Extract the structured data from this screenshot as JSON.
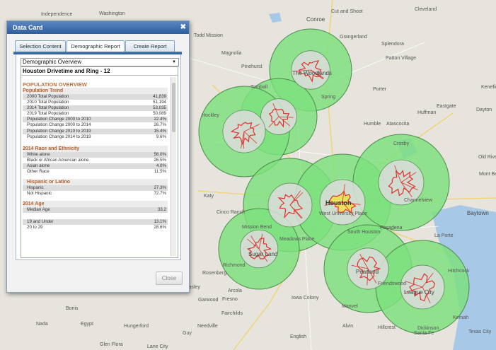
{
  "dialog": {
    "title": "Data Card",
    "close_icon": "close-icon",
    "tabs": [
      {
        "label": "Selection Content"
      },
      {
        "label": "Demographic Report"
      },
      {
        "label": "Create Report"
      }
    ],
    "active_tab": "Demographic Report",
    "select_value": "Demographic Overview",
    "report_title": "Houston Drivetime and Ring - 12",
    "close_button": "Close"
  },
  "report": {
    "overview_heading": "POPULATION OVERVIEW",
    "population_trend_heading": "Population Trend",
    "population_trend": [
      {
        "label": "2000 Total Population",
        "value": "41,839"
      },
      {
        "label": "2010 Total Population",
        "value": "51,194"
      },
      {
        "label": "2014 Total Population",
        "value": "53,035"
      },
      {
        "label": "2019 Total Population",
        "value": "50,089"
      },
      {
        "label": "Population Change 2000 to 2010",
        "value": "22.4%"
      },
      {
        "label": "Population Change 2000 to 2014",
        "value": "26.7%"
      },
      {
        "label": "Population Change 2010 to 2019",
        "value": "15.4%"
      },
      {
        "label": "Population Change 2014 to 2019",
        "value": "9.6%"
      }
    ],
    "race_heading": "2014 Race and Ethnicity",
    "race": [
      {
        "label": "White alone",
        "value": "56.0%"
      },
      {
        "label": "Black or African American alone",
        "value": "26.5%"
      },
      {
        "label": "Asian alone",
        "value": "4.0%"
      },
      {
        "label": "Other Race",
        "value": "11.5%"
      }
    ],
    "hispanic_heading": "Hispanic or Latino",
    "hispanic": [
      {
        "label": "Hispanic",
        "value": "27.3%"
      },
      {
        "label": "Not Hispanic",
        "value": "72.7%"
      }
    ],
    "age_heading": "2014 Age",
    "age": [
      {
        "label": "Median Age",
        "value": "33.2"
      },
      {
        "label": "",
        "value": ""
      },
      {
        "label": "19 and Under",
        "value": "13.1%"
      },
      {
        "label": "20 to 29",
        "value": "28.6%"
      }
    ]
  },
  "map": {
    "labels": [
      {
        "text": "Independence",
        "cls": ""
      },
      {
        "text": "Washington",
        "cls": ""
      },
      {
        "text": "Todd Mission",
        "cls": ""
      },
      {
        "text": "Magnolia",
        "cls": ""
      },
      {
        "text": "Pinehurst",
        "cls": ""
      },
      {
        "text": "Conroe",
        "cls": "mid"
      },
      {
        "text": "Cut and Shoot",
        "cls": ""
      },
      {
        "text": "Cleveland",
        "cls": ""
      },
      {
        "text": "Grangerland",
        "cls": ""
      },
      {
        "text": "Splendora",
        "cls": ""
      },
      {
        "text": "Patton Village",
        "cls": ""
      },
      {
        "text": "The Woodlands",
        "cls": "mid"
      },
      {
        "text": "Porter",
        "cls": ""
      },
      {
        "text": "Tomball",
        "cls": ""
      },
      {
        "text": "Spring",
        "cls": ""
      },
      {
        "text": "Kenefick",
        "cls": ""
      },
      {
        "text": "Hockley",
        "cls": ""
      },
      {
        "text": "Humble",
        "cls": ""
      },
      {
        "text": "Atascocita",
        "cls": ""
      },
      {
        "text": "Huffman",
        "cls": ""
      },
      {
        "text": "Eastgate",
        "cls": ""
      },
      {
        "text": "Dayton",
        "cls": ""
      },
      {
        "text": "Crosby",
        "cls": ""
      },
      {
        "text": "Old River-",
        "cls": ""
      },
      {
        "text": "Mont Belvieu",
        "cls": ""
      },
      {
        "text": "Katy",
        "cls": ""
      },
      {
        "text": "Houston",
        "cls": "big"
      },
      {
        "text": "Channelview",
        "cls": ""
      },
      {
        "text": "Cinco Ranch",
        "cls": ""
      },
      {
        "text": "West University Place",
        "cls": ""
      },
      {
        "text": "Baytown",
        "cls": "mid"
      },
      {
        "text": "Mission Bend",
        "cls": ""
      },
      {
        "text": "Meadows Place",
        "cls": ""
      },
      {
        "text": "Pasadena",
        "cls": ""
      },
      {
        "text": "Sugar Land",
        "cls": "mid"
      },
      {
        "text": "South Houston",
        "cls": ""
      },
      {
        "text": "La Porte",
        "cls": ""
      },
      {
        "text": "Pearland",
        "cls": "mid"
      },
      {
        "text": "Friendswood",
        "cls": ""
      },
      {
        "text": "League City",
        "cls": "mid"
      },
      {
        "text": "Richmond",
        "cls": ""
      },
      {
        "text": "Rosenberg",
        "cls": ""
      },
      {
        "text": "Beasley",
        "cls": ""
      },
      {
        "text": "Arcola",
        "cls": ""
      },
      {
        "text": "Fresno",
        "cls": ""
      },
      {
        "text": "Manvel",
        "cls": ""
      },
      {
        "text": "Iowa Colony",
        "cls": ""
      },
      {
        "text": "Alvin",
        "cls": ""
      },
      {
        "text": "Dickinson",
        "cls": ""
      },
      {
        "text": "Kemah",
        "cls": ""
      },
      {
        "text": "Santa Fe",
        "cls": ""
      },
      {
        "text": "Texas City",
        "cls": ""
      },
      {
        "text": "Garwood",
        "cls": ""
      },
      {
        "text": "Boriis",
        "cls": ""
      },
      {
        "text": "Nada",
        "cls": ""
      },
      {
        "text": "Egypt",
        "cls": ""
      },
      {
        "text": "Hungerford",
        "cls": ""
      },
      {
        "text": "Needville",
        "cls": ""
      },
      {
        "text": "Fairchilds",
        "cls": ""
      },
      {
        "text": "Guy",
        "cls": ""
      },
      {
        "text": "English",
        "cls": ""
      },
      {
        "text": "Hillcrest",
        "cls": ""
      },
      {
        "text": "Glen Flora",
        "cls": ""
      },
      {
        "text": "Lane City",
        "cls": ""
      },
      {
        "text": "Hitchcock",
        "cls": ""
      }
    ],
    "colors": {
      "ring_fill": "#7de07d",
      "ring_stroke": "#4a8a4a",
      "inner_fill": "#dcdcdc",
      "boundary": "#e03030",
      "land": "#e6e4dc",
      "water": "#a8c8e8"
    }
  }
}
